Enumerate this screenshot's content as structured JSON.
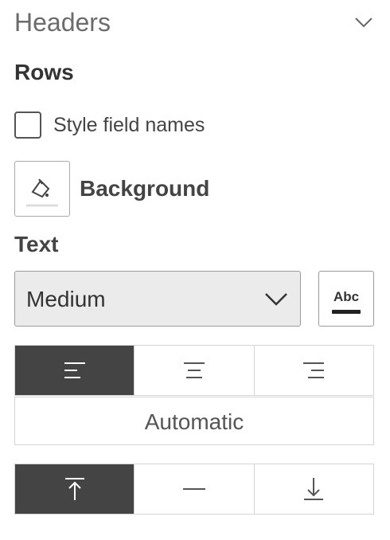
{
  "panel": {
    "title": "Headers",
    "collapse_icon": "chevron-down-icon"
  },
  "rows": {
    "label": "Rows",
    "style_field_names": {
      "label": "Style field names",
      "checked": false
    },
    "background": {
      "label": "Background",
      "icon": "paint-bucket-icon"
    }
  },
  "text": {
    "label": "Text",
    "size_select": {
      "value": "Medium",
      "icon": "chevron-down-icon"
    },
    "color_button": {
      "label": "Abc",
      "swatch_color": "#222222"
    },
    "horizontal_align": {
      "options": [
        "align-left",
        "align-center",
        "align-right"
      ],
      "selected": "align-left"
    },
    "wrap_mode": {
      "label": "Automatic"
    },
    "vertical_align": {
      "options": [
        "align-top",
        "align-middle",
        "align-bottom"
      ],
      "selected": "align-top"
    }
  },
  "colors": {
    "active_segment": "#444444",
    "border": "#d5d5d5",
    "select_bg": "#ebebeb"
  }
}
